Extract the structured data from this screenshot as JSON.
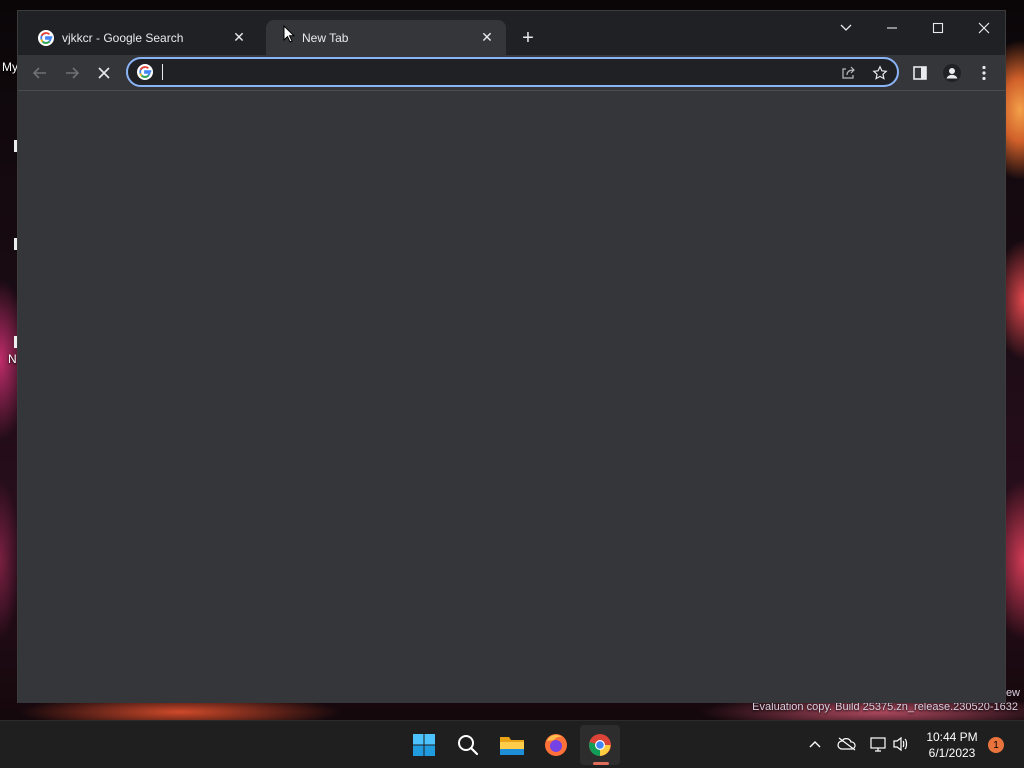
{
  "desktop": {
    "labels": [
      "My",
      "N"
    ],
    "watermark": "Evaluation copy. Build 25375.zn_release.230520-1632",
    "watermark_suffix": "ew"
  },
  "browser": {
    "tabs": [
      {
        "title": "vjkkcr - Google Search",
        "favicon": "google-g-icon",
        "close": "✕",
        "active": false
      },
      {
        "title": "New Tab",
        "favicon": "none",
        "close": "✕",
        "active": true
      }
    ],
    "new_tab_label": "+",
    "window_controls": {
      "tab_search": "chevron-down-icon",
      "minimize": "minimize-icon",
      "maximize": "maximize-icon",
      "close": "close-icon"
    },
    "toolbar": {
      "back": "back-arrow-icon",
      "forward": "forward-arrow-icon",
      "stop": "stop-loading-icon",
      "address_value": "",
      "address_placeholder": "",
      "share": "share-icon",
      "bookmark": "star-icon",
      "side_panel": "side-panel-icon",
      "profile": "profile-icon",
      "menu": "kebab-menu-icon"
    },
    "colors": {
      "frame": "#202124",
      "toolbar": "#35363a",
      "focus_ring": "#8ab4f8"
    }
  },
  "taskbar": {
    "apps": [
      {
        "name": "start-button",
        "icon": "windows-logo-icon"
      },
      {
        "name": "search-button",
        "icon": "search-icon"
      },
      {
        "name": "file-explorer",
        "icon": "folder-icon"
      },
      {
        "name": "firefox",
        "icon": "firefox-icon"
      },
      {
        "name": "chrome",
        "icon": "chrome-icon",
        "active": true
      }
    ],
    "tray": {
      "overflow": "chevron-up-icon",
      "cloud": "cloud-off-icon",
      "network": "network-icon",
      "volume": "volume-icon"
    },
    "time": "10:44 PM",
    "date": "6/1/2023",
    "notification_count": "1"
  }
}
